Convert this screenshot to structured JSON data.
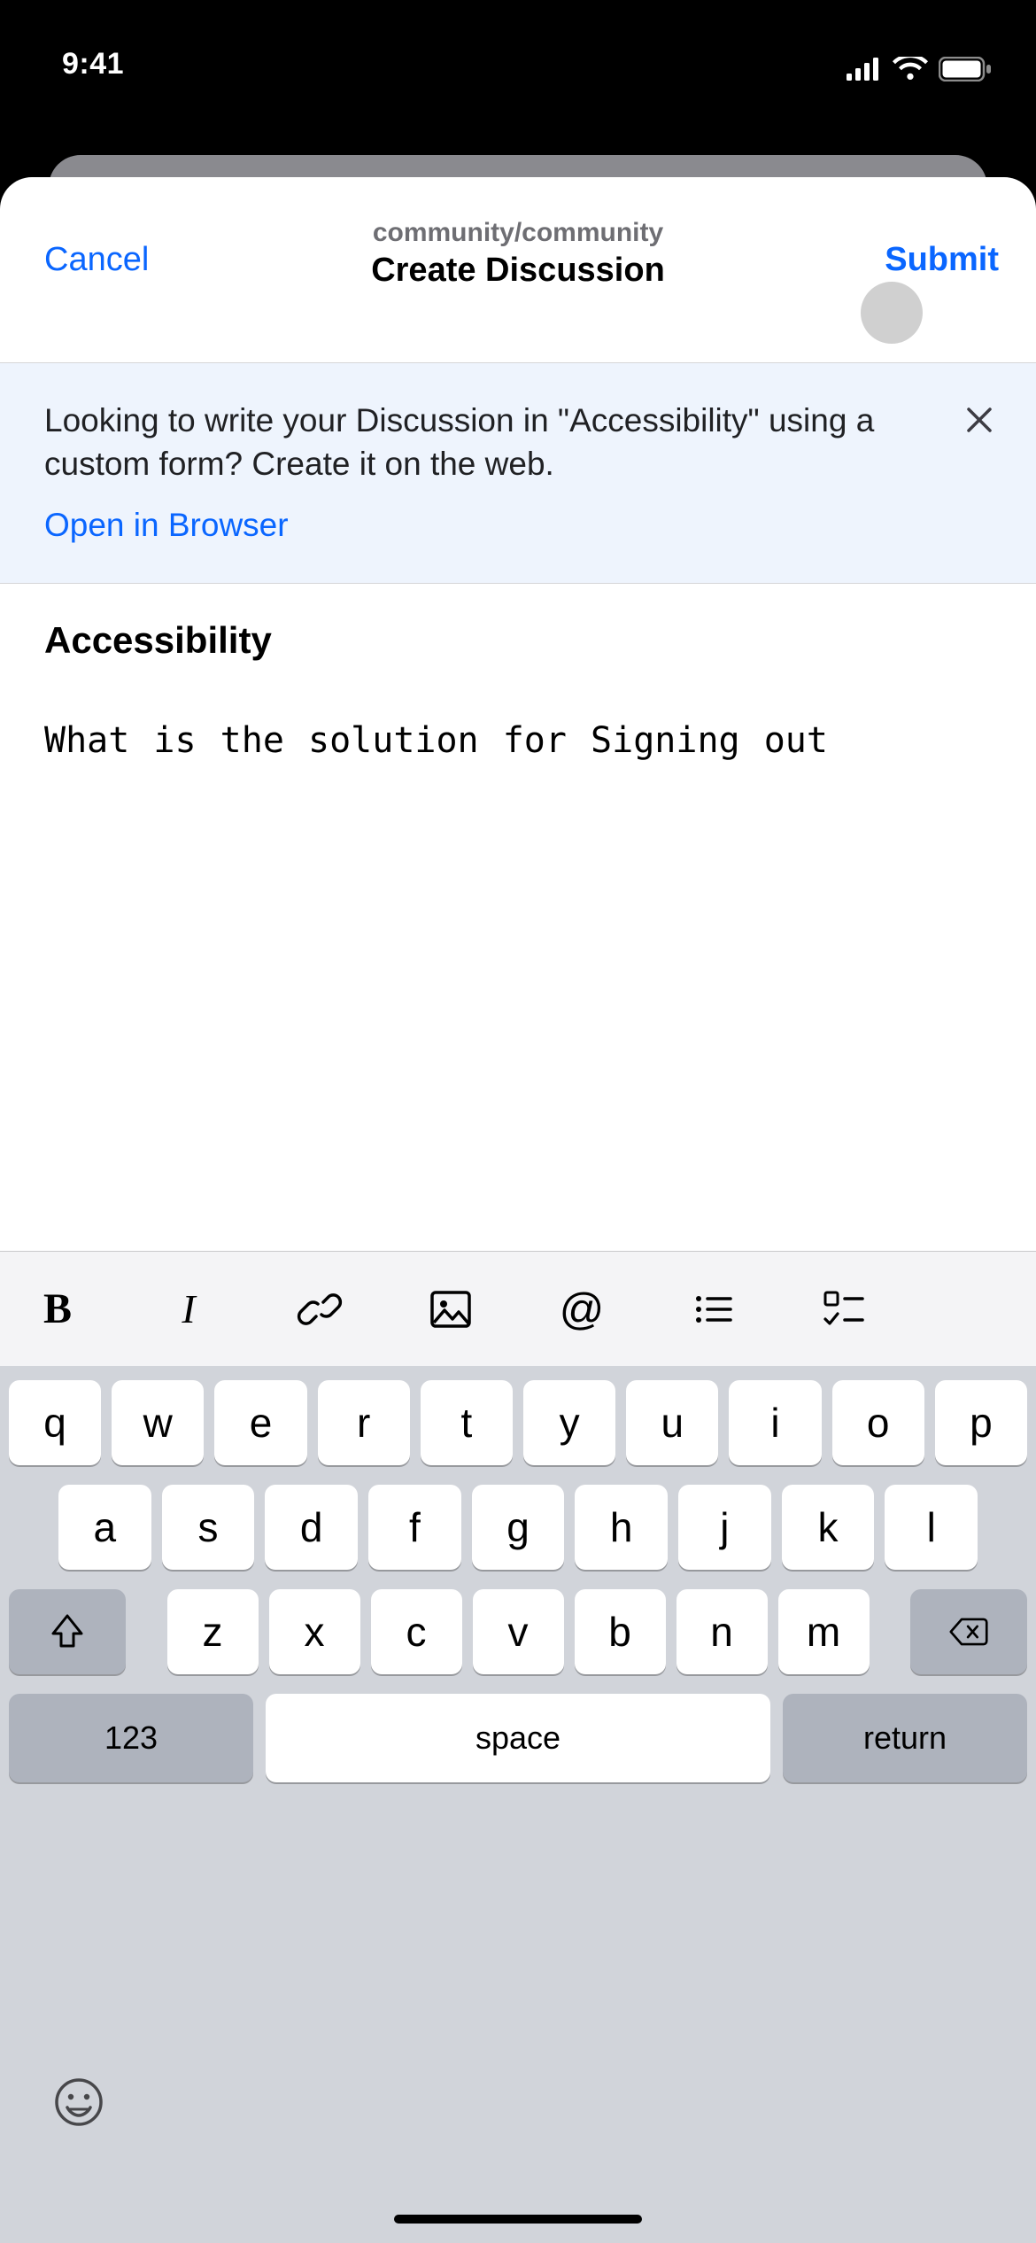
{
  "status": {
    "time": "9:41"
  },
  "header": {
    "cancel": "Cancel",
    "submit": "Submit",
    "context": "community/community",
    "title": "Create Discussion"
  },
  "banner": {
    "text": "Looking to write your Discussion in \"Accessibility\" using a custom form? Create it on the web.",
    "link": "Open in Browser"
  },
  "editor": {
    "heading": "Accessibility",
    "body": "What is the solution for Signing out"
  },
  "keyboard": {
    "row1": [
      "q",
      "w",
      "e",
      "r",
      "t",
      "y",
      "u",
      "i",
      "o",
      "p"
    ],
    "row2": [
      "a",
      "s",
      "d",
      "f",
      "g",
      "h",
      "j",
      "k",
      "l"
    ],
    "row3": [
      "z",
      "x",
      "c",
      "v",
      "b",
      "n",
      "m"
    ],
    "numbers": "123",
    "space": "space",
    "return": "return"
  }
}
